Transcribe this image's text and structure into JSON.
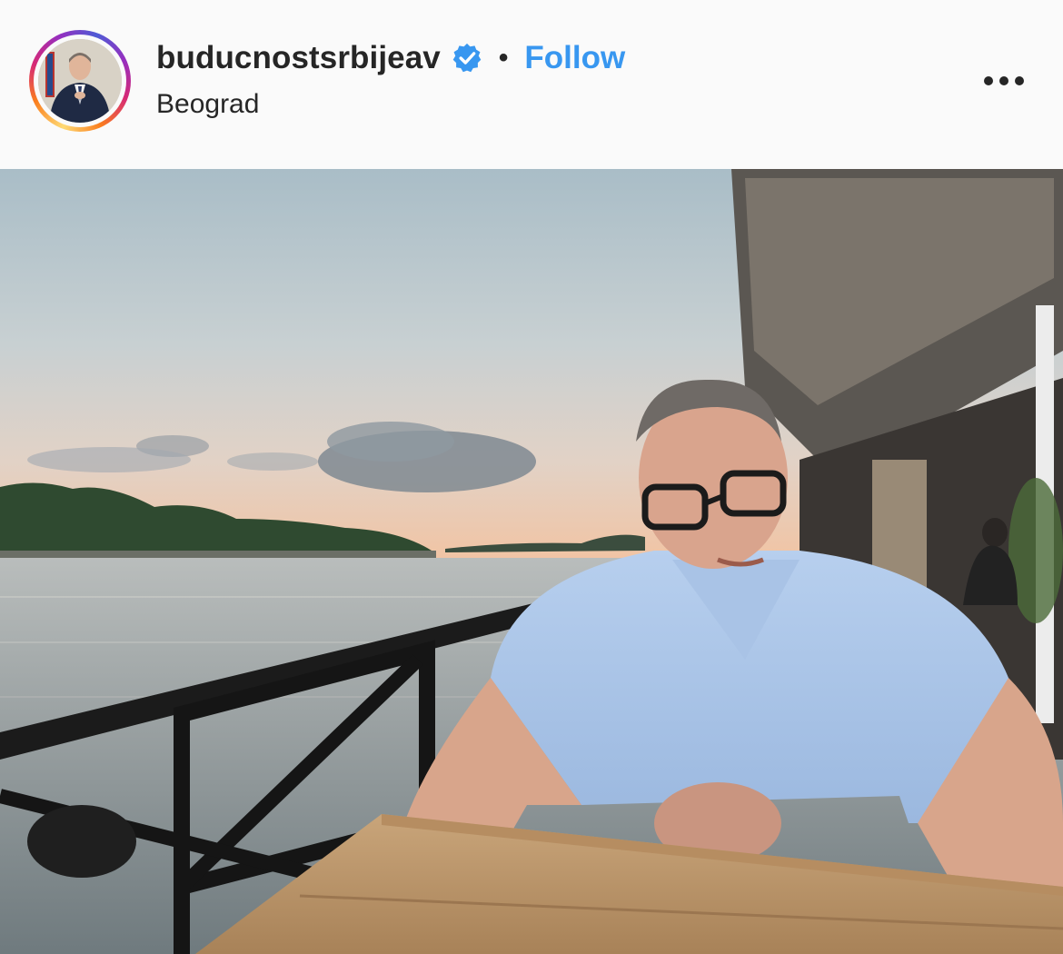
{
  "post": {
    "username": "buducnostsrbijeav",
    "verified": true,
    "separator": "•",
    "follow_label": "Follow",
    "location": "Beograd"
  },
  "icons": {
    "verified": "verified-badge-icon",
    "more": "more-options-icon"
  },
  "colors": {
    "follow_blue": "#3897f0",
    "verified_blue": "#3897f0",
    "text": "#262626",
    "background": "#fafafa"
  }
}
